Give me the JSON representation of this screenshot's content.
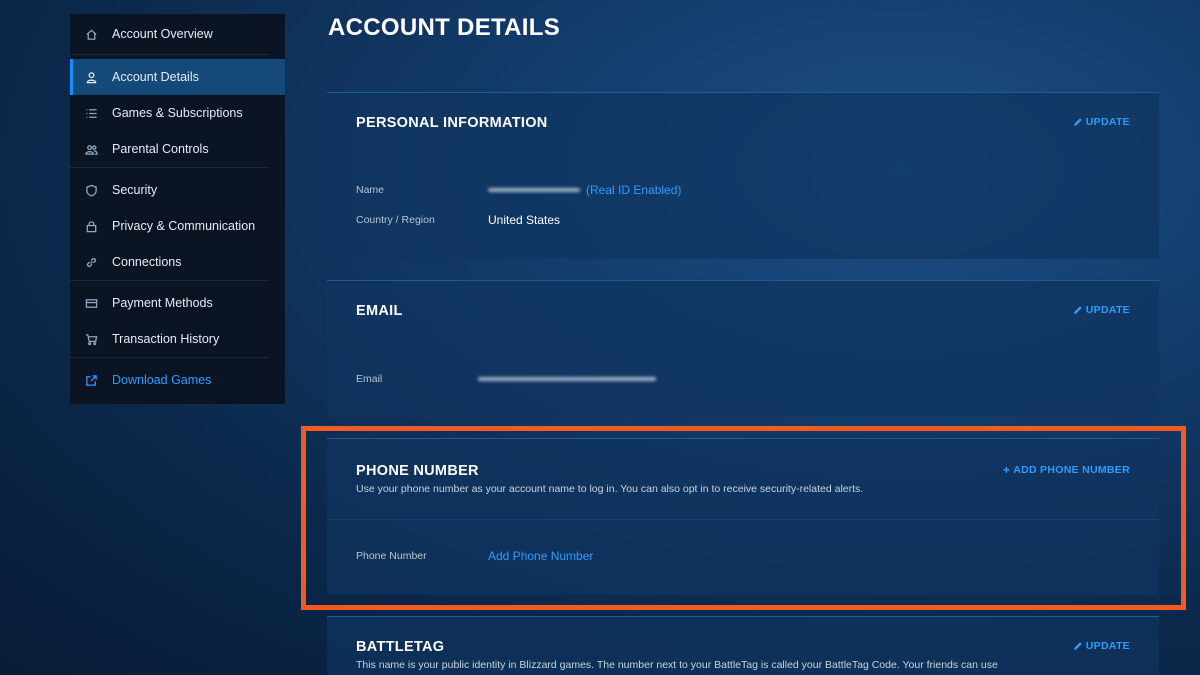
{
  "sidebar": {
    "items": [
      {
        "label": "Account Overview",
        "icon": "home-icon"
      },
      {
        "label": "Account Details",
        "icon": "user-icon"
      },
      {
        "label": "Games & Subscriptions",
        "icon": "list-icon"
      },
      {
        "label": "Parental Controls",
        "icon": "users-icon"
      },
      {
        "label": "Security",
        "icon": "shield-icon"
      },
      {
        "label": "Privacy & Communication",
        "icon": "lock-icon"
      },
      {
        "label": "Connections",
        "icon": "link-icon"
      },
      {
        "label": "Payment Methods",
        "icon": "credit-card-icon"
      },
      {
        "label": "Transaction History",
        "icon": "cart-icon"
      },
      {
        "label": "Download Games",
        "icon": "external-link-icon"
      }
    ],
    "active": "Account Details"
  },
  "page": {
    "title": "ACCOUNT DETAILS"
  },
  "personal": {
    "title": "PERSONAL INFORMATION",
    "action": "UPDATE",
    "name_label": "Name",
    "name_note": "(Real ID Enabled)",
    "country_label": "Country / Region",
    "country_value": "United States"
  },
  "email": {
    "title": "EMAIL",
    "action": "UPDATE",
    "email_label": "Email"
  },
  "phone": {
    "title": "PHONE NUMBER",
    "action": "ADD PHONE NUMBER",
    "description": "Use your phone number as your account name to log in. You can also opt in to receive security-related alerts.",
    "field_label": "Phone Number",
    "field_link": "Add Phone Number"
  },
  "battletag": {
    "title": "BATTLETAG",
    "action": "UPDATE",
    "description": "This name is your public identity in Blizzard games. The number next to your BattleTag is called your BattleTag Code. Your friends can use"
  },
  "colors": {
    "accent": "#2f9bff",
    "highlight": "#f05a24",
    "sidebar_bg": "#0a1422",
    "active_bg": "#14497a"
  }
}
